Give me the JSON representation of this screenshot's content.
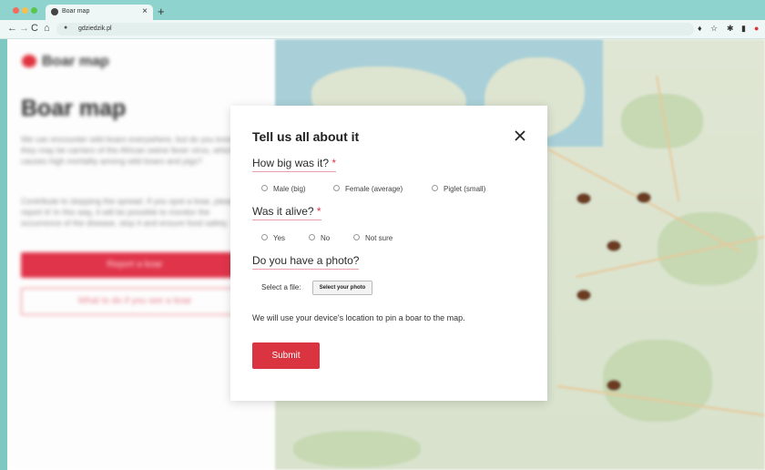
{
  "browser": {
    "tab_title": "Boar map",
    "tab_close": "×",
    "new_tab": "+",
    "url": "gdziedzik.pl",
    "nav": {
      "back": "←",
      "forward": "→",
      "reload": "C",
      "home": "⌂"
    }
  },
  "sidebar": {
    "logo_text": "Boar map",
    "heading": "Boar map",
    "paragraph_1": "We can encounter wild boars everywhere, but do you know they may be carriers of the African swine fever virus, which causes high mortality among wild boars and pigs?",
    "paragraph_2": "Contribute to stopping the spread. If you spot a boar, please report it! In this way, it will be possible to monitor the occurrence of the disease, stop it and ensure food safety.",
    "report_button": "Report a boar",
    "what_to_do_button": "What to do if you see a boar"
  },
  "modal": {
    "title": "Tell us all about it",
    "q1": {
      "label": "How big was it?",
      "required": "*",
      "options": [
        "Male (big)",
        "Female (average)",
        "Piglet (small)"
      ]
    },
    "q2": {
      "label": "Was it alive?",
      "required": "*",
      "options": [
        "Yes",
        "No",
        "Not sure"
      ]
    },
    "q3": {
      "label": "Do you have a photo?",
      "file_label": "Select a file:",
      "file_button": "Select your photo"
    },
    "location_note": "We will use your device's location to pin a boar to the map.",
    "submit": "Submit"
  },
  "colors": {
    "brand": "#e0344a",
    "submit": "#d9343f",
    "boar_pin": "#6a3a21"
  }
}
